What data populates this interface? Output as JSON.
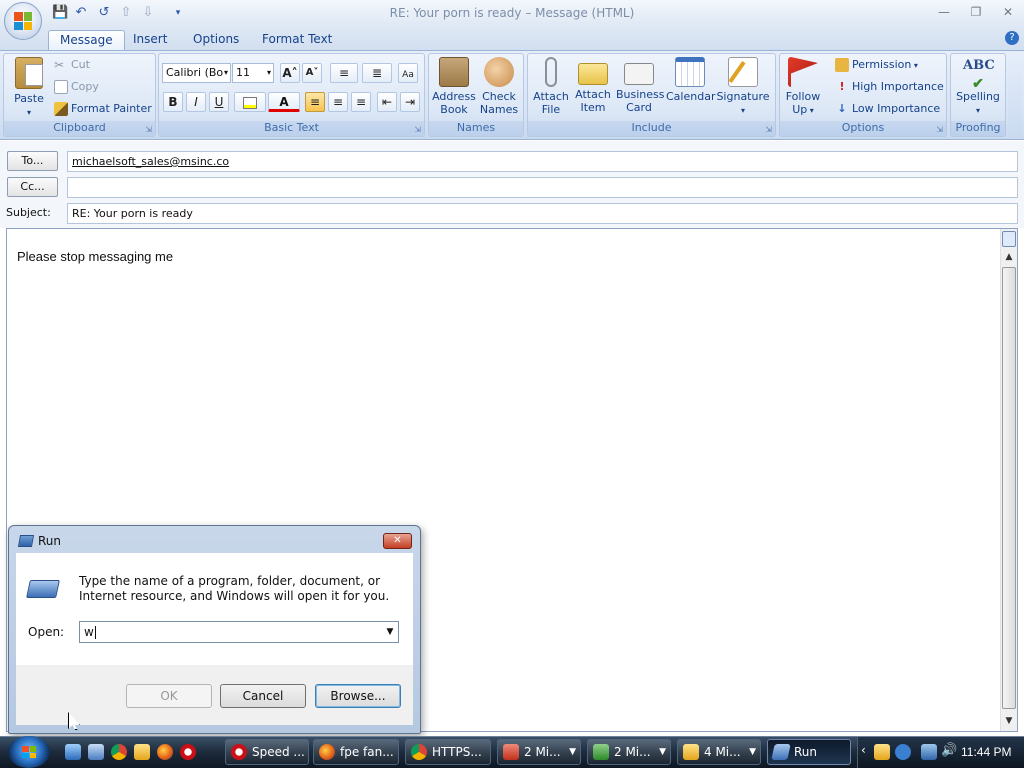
{
  "window": {
    "title": "RE: Your porn is ready – Message (HTML)",
    "controls": {
      "minimize": "—",
      "restore": "❐",
      "close": "✕"
    }
  },
  "quick_access": [
    "save-icon",
    "undo-icon",
    "redo-icon",
    "up-arrow-icon",
    "down-arrow-icon",
    "customize-icon"
  ],
  "tabs": [
    "Message",
    "Insert",
    "Options",
    "Format Text"
  ],
  "ribbon": {
    "clipboard": {
      "label": "Clipboard",
      "paste": "Paste",
      "cut": "Cut",
      "copy": "Copy",
      "format_painter": "Format Painter"
    },
    "basic_text": {
      "label": "Basic Text",
      "font": "Calibri (Bo",
      "size": "11",
      "bold": "B",
      "italic": "I",
      "underline": "U",
      "grow": "A˄",
      "shrink": "A˅"
    },
    "names": {
      "label": "Names",
      "address_book_1": "Address",
      "address_book_2": "Book",
      "check_names_1": "Check",
      "check_names_2": "Names"
    },
    "include": {
      "label": "Include",
      "attach_file_1": "Attach",
      "attach_file_2": "File",
      "attach_item_1": "Attach",
      "attach_item_2": "Item",
      "business_card_1": "Business",
      "business_card_2": "Card",
      "calendar": "Calendar",
      "signature": "Signature"
    },
    "options": {
      "label": "Options",
      "follow_up_1": "Follow",
      "follow_up_2": "Up",
      "permission": "Permission",
      "high_importance": "High Importance",
      "low_importance": "Low Importance"
    },
    "proofing": {
      "label": "Proofing",
      "spelling": "Spelling",
      "abc": "ABC"
    }
  },
  "header": {
    "to_button": "To...",
    "to_value": "michaelsoft_sales@msinc.co",
    "cc_button": "Cc...",
    "cc_value": "",
    "subject_label": "Subject:",
    "subject_value": "RE: Your porn is ready"
  },
  "body": {
    "text": "Please stop messaging me"
  },
  "run_dialog": {
    "title": "Run",
    "description": "Type the name of a program, folder, document, or Internet resource, and Windows will open it for you.",
    "open_label": "Open:",
    "open_value": "w",
    "ok": "OK",
    "cancel": "Cancel",
    "browse": "Browse..."
  },
  "taskbar": {
    "items": [
      "Speed ...",
      "fpe fan...",
      "HTTPS...",
      "2 Mi...",
      "2 Mi...",
      "4 Mi...",
      "Run"
    ],
    "clock": "11:44 PM"
  }
}
